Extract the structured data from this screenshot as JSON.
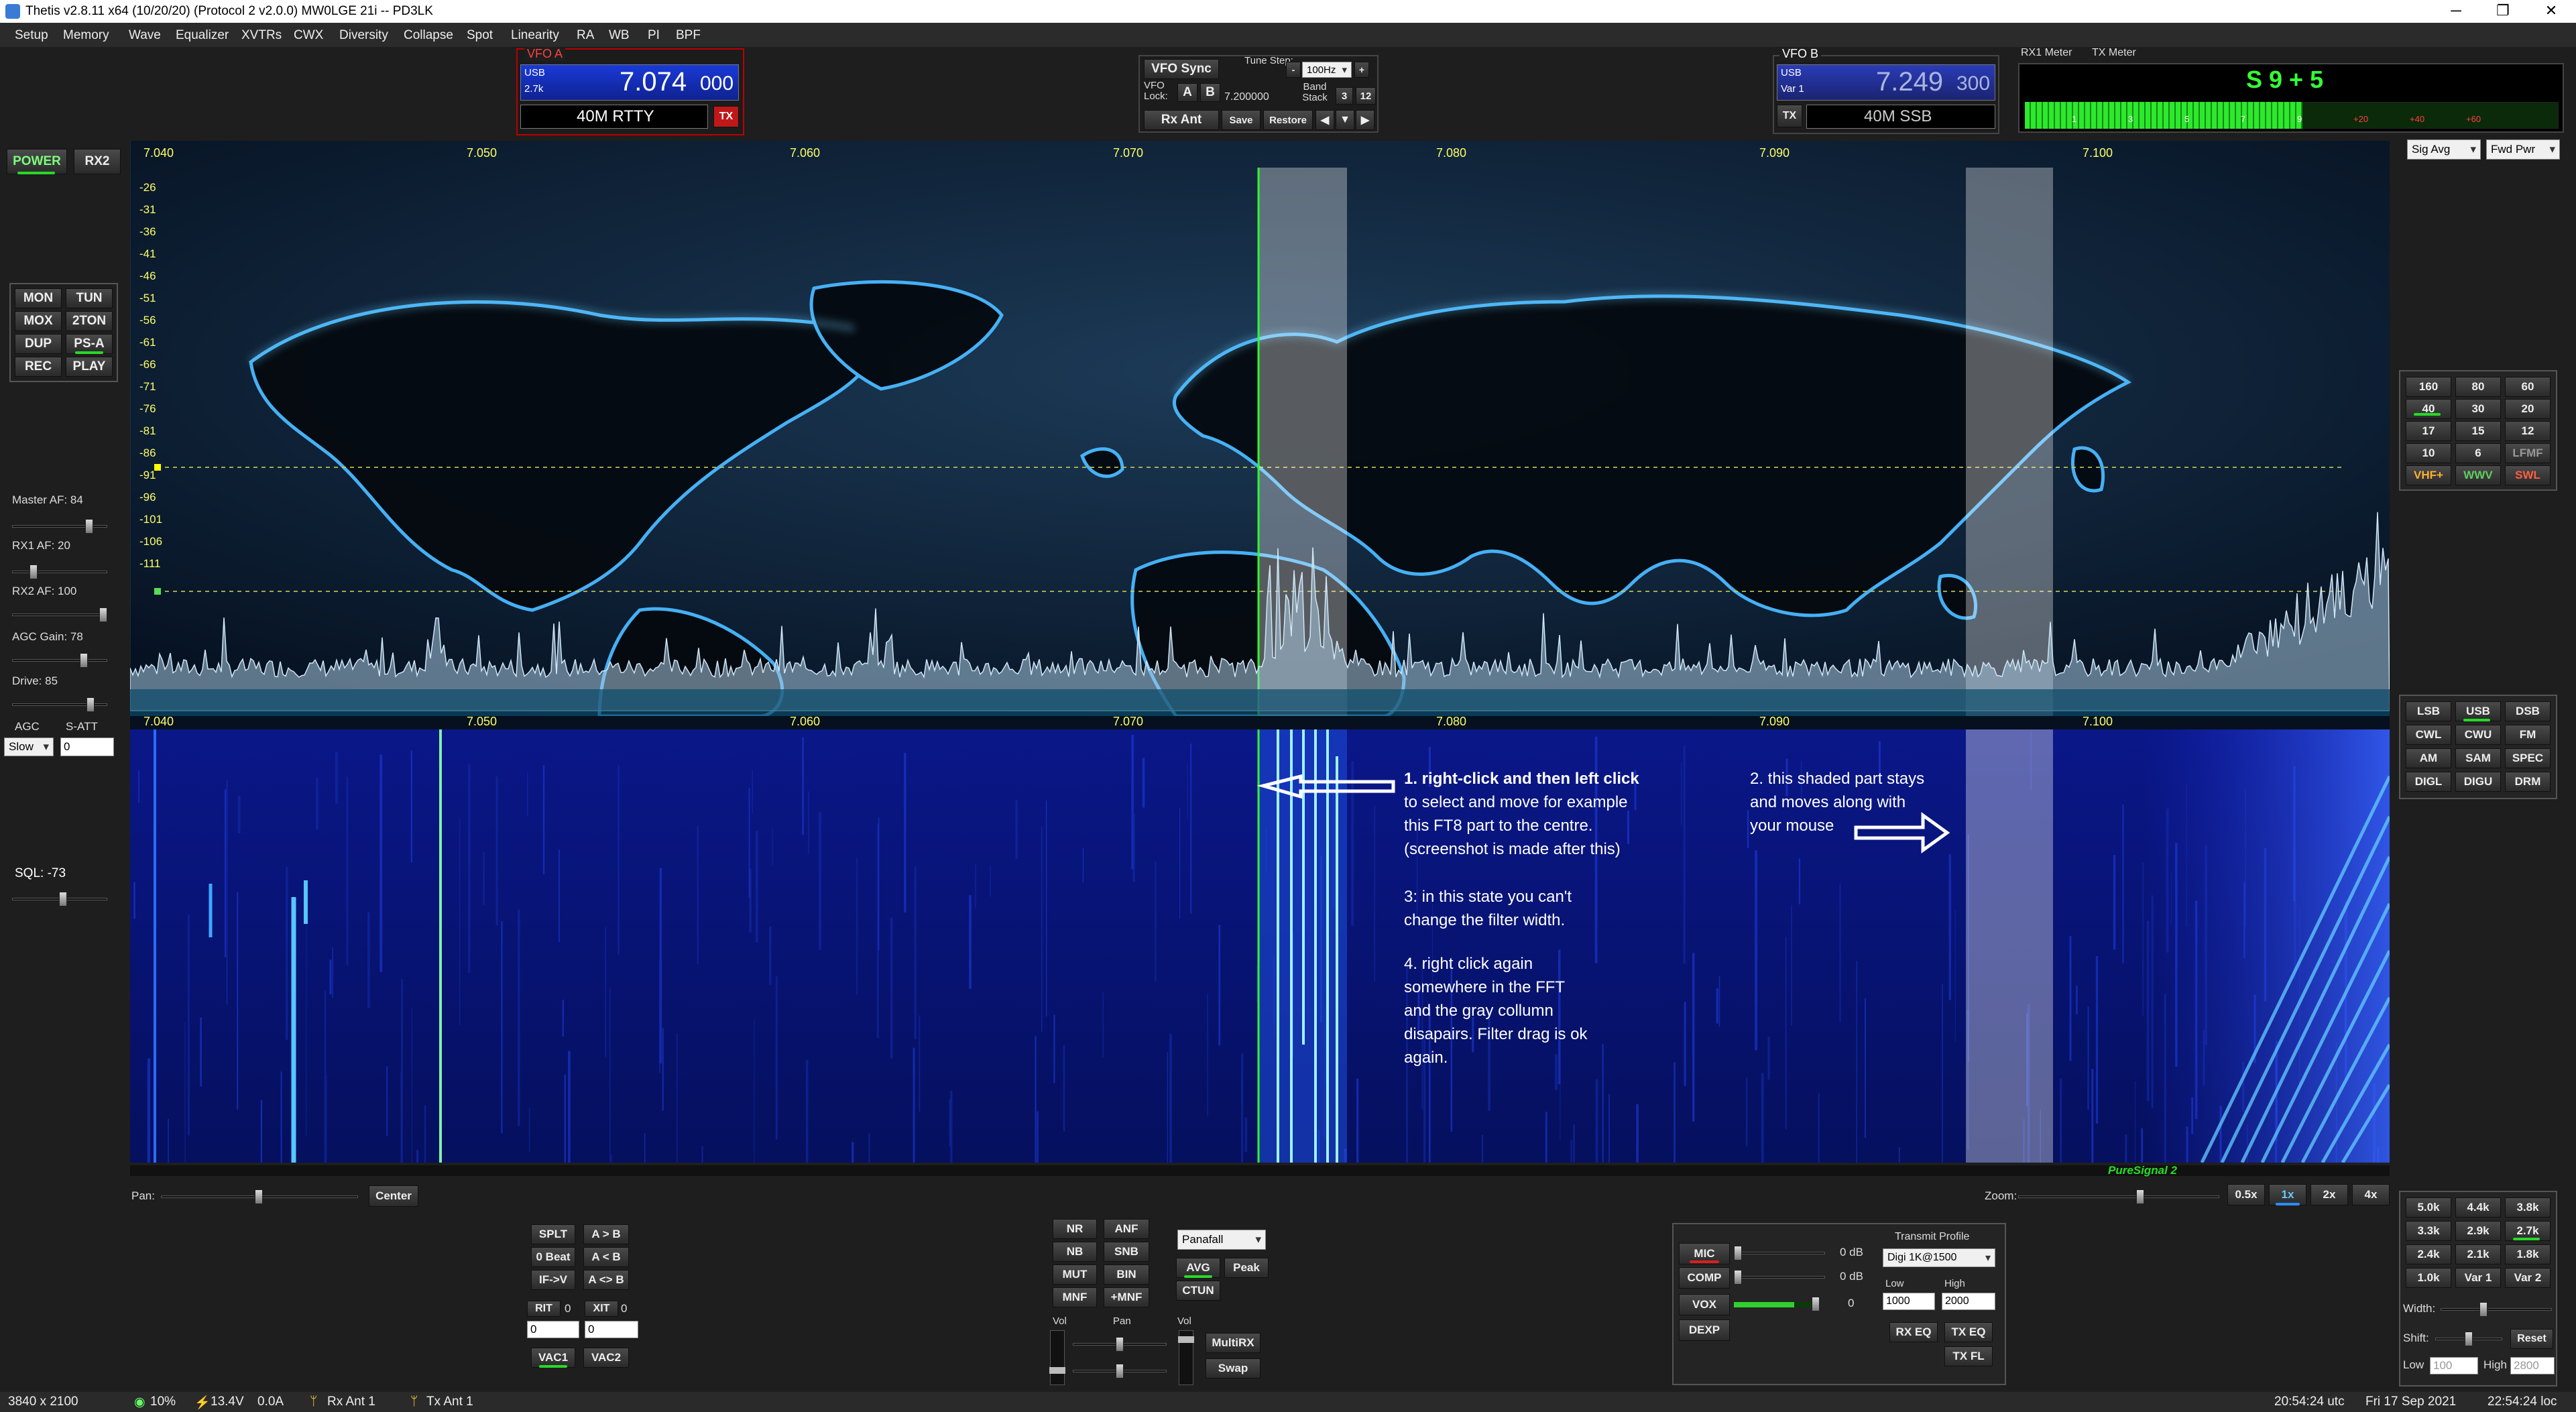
{
  "window": {
    "title": "Thetis v2.8.11 x64 (10/20/20) (Protocol 2 v2.0.0) MW0LGE 21i  --  PD3LK",
    "minimize": "─",
    "maximize": "❐",
    "close": "✕"
  },
  "menu": [
    "Setup",
    "Memory",
    "Wave",
    "Equalizer",
    "XVTRs",
    "CWX",
    "Diversity",
    "Collapse",
    "Spot",
    "Linearity",
    "RA",
    "WB",
    "PI",
    "BPF"
  ],
  "left_panel": {
    "power": "POWER",
    "rx2": "RX2",
    "mode_buttons": [
      "MON",
      "TUN",
      "MOX",
      "2TON",
      "DUP",
      "PS-A",
      "REC",
      "PLAY"
    ],
    "master_af": "Master AF:  84",
    "master_af_level": 84,
    "rx1_af": "RX1 AF:  20",
    "rx1_af_level": 20,
    "rx2_af": "RX2 AF:  100",
    "rx2_af_level": 100,
    "agc_gain": "AGC Gain:  78",
    "agc_gain_level": 78,
    "drive": "Drive:  85",
    "drive_level": 85,
    "agc": "AGC",
    "satt": "S-ATT",
    "agc_value": "Slow",
    "satt_value": "0",
    "sql": "SQL: -73"
  },
  "vfo_a": {
    "label": "VFO A",
    "mode": "USB",
    "bw": "2.7k",
    "freq_main": "7.074",
    "freq_sub": "000",
    "band": "40M RTTY",
    "tx": "TX"
  },
  "vfo_center": {
    "sync": "VFO Sync",
    "tune_step": "Tune Step:",
    "step_value": "100Hz",
    "vfo_lock": "VFO Lock:",
    "a": "A",
    "b": "B",
    "lock_freq": "7.200000",
    "band_stack": "Band Stack",
    "bs1": "3",
    "bs2": "12",
    "rx_ant": "Rx Ant",
    "save": "Save",
    "restore": "Restore",
    "arrow_left": "◀",
    "arrow_down": "▼",
    "arrow_right": "▶"
  },
  "vfo_b": {
    "label": "VFO B",
    "mode": "USB",
    "bw": "Var 1",
    "freq_main": "7.249",
    "freq_sub": "300",
    "tx": "TX",
    "band": "40M SSB"
  },
  "meter": {
    "rx1_label": "RX1 Meter",
    "tx_label": "TX Meter",
    "reading": "S 9 + 5",
    "scale": [
      "1",
      "3",
      "5",
      "7",
      "9",
      "+20",
      "+40",
      "+60"
    ],
    "level": 0.52,
    "sel1": "Sig Avg",
    "sel2": "Fwd Pwr"
  },
  "spectrum": {
    "freq_ticks": [
      "7.040",
      "7.050",
      "7.060",
      "7.070",
      "7.080",
      "7.090",
      "7.100"
    ],
    "db_ticks": [
      "-26",
      "-31",
      "-36",
      "-41",
      "-46",
      "-51",
      "-56",
      "-61",
      "-66",
      "-71",
      "-76",
      "-81",
      "-86",
      "-91",
      "-96",
      "-101",
      "-106",
      "-111"
    ]
  },
  "waterfall": {
    "freq_ticks": [
      "7.040",
      "7.050",
      "7.060",
      "7.070",
      "7.080",
      "7.090",
      "7.100"
    ]
  },
  "annotations": {
    "n1_title": "1. right-click and then left click",
    "n1_body": "to select and move for example\nthis FT8 part to the centre.\n(screenshot is made after this)",
    "n3": "3: in this state you can't\nchange the filter width.",
    "n4": "4. right click again\nsomewhere in the FFT\nand the gray collumn\ndisapairs. Filter drag is ok\nagain.",
    "n2": "2. this shaded part stays\nand moves along with\nyour mouse"
  },
  "bands": [
    "160",
    "80",
    "60",
    "40",
    "30",
    "20",
    "17",
    "15",
    "12",
    "10",
    "6",
    "LFMF",
    "VHF+",
    "WWV",
    "SWL"
  ],
  "modes": [
    "LSB",
    "USB",
    "DSB",
    "CWL",
    "CWU",
    "FM",
    "AM",
    "SAM",
    "SPEC",
    "DIGL",
    "DIGU",
    "DRM"
  ],
  "filters": [
    "5.0k",
    "4.4k",
    "3.8k",
    "3.3k",
    "2.9k",
    "2.7k",
    "2.4k",
    "2.1k",
    "1.8k",
    "1.0k",
    "Var 1",
    "Var 2"
  ],
  "filter_controls": {
    "width": "Width:",
    "shift": "Shift:",
    "reset": "Reset",
    "low": "Low",
    "high": "High",
    "low_val": "100",
    "high_val": "2800"
  },
  "pan": {
    "label": "Pan:",
    "center": "Center",
    "zoom": "Zoom:",
    "zooms": [
      "0.5x",
      "1x",
      "2x",
      "4x"
    ],
    "puresignal": "PureSignal 2"
  },
  "vfo_ops": {
    "splt": "SPLT",
    "a_b": "A > B",
    "zero_beat": "0 Beat",
    "b_a": "A < B",
    "if_v": "IF->V",
    "swap": "A <> B",
    "rit": "RIT",
    "rit_val": "0",
    "xit": "XIT",
    "xit_val": "0",
    "rit_num": "0",
    "xit_num": "0",
    "vac1": "VAC1",
    "vac2": "VAC2"
  },
  "dsp": {
    "nr": "NR",
    "anf": "ANF",
    "nb": "NB",
    "snb": "SNB",
    "mut": "MUT",
    "bin": "BIN",
    "mnf": "MNF",
    "pmnf": "+MNF",
    "display_mode": "Panafall",
    "avg": "AVG",
    "peak": "Peak",
    "ctun": "CTUN",
    "vol": "Vol",
    "pan": "Pan",
    "vol2": "Vol",
    "multirx": "MultiRX",
    "swap": "Swap"
  },
  "tx": {
    "mic": "MIC",
    "comp": "COMP",
    "vox": "VOX",
    "dexp": "DEXP",
    "mic_db": "0 dB",
    "comp_db": "0 dB",
    "vox_val": "0",
    "profile_label": "Transmit Profile",
    "profile": "Digi 1K@1500",
    "low": "Low",
    "high": "High",
    "low_val": "1000",
    "high_val": "2000",
    "rx_eq": "RX EQ",
    "tx_eq": "TX EQ",
    "tx_fl": "TX FL"
  },
  "status": {
    "res": "3840 x 2100",
    "cpu": "10%",
    "volt": "13.4V",
    "amp": "0.0A",
    "rx_ant": "Rx Ant 1",
    "tx_ant": "Tx Ant 1",
    "utc": "20:54:24 utc",
    "date": "Fri 17 Sep 2021",
    "loc": "22:54:24 loc"
  }
}
